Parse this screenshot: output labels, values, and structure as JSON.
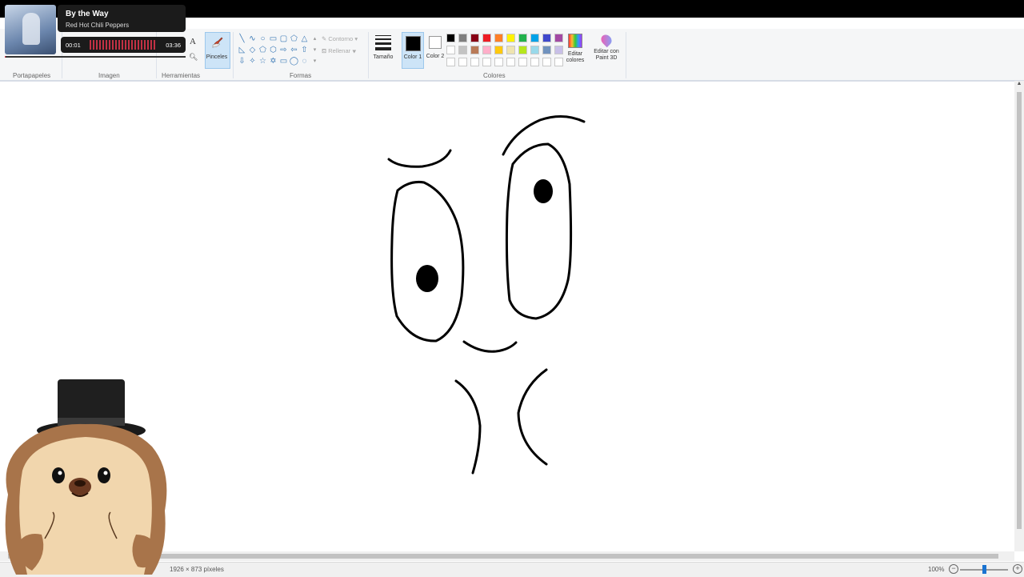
{
  "ribbon": {
    "groups": {
      "clipboard": "Portapapeles",
      "image": "Imagen",
      "tools": "Herramientas",
      "shapes": "Formas",
      "colors": "Colores"
    },
    "brushes_label": "Pinceles",
    "outline_label": "Contorno",
    "fill_label": "Rellenar",
    "size_label": "Tamaño",
    "color1_label": "Color 1",
    "color2_label": "Color 2",
    "edit_colors_label": "Editar colores",
    "paint3d_label": "Editar con Paint 3D",
    "color1_value": "#000000",
    "color2_value": "#ffffff",
    "palette": [
      "#000000",
      "#7f7f7f",
      "#880015",
      "#ed1c24",
      "#ff7f27",
      "#fff200",
      "#22b14c",
      "#00a2e8",
      "#3f48cc",
      "#a349a4",
      "#ffffff",
      "#c3c3c3",
      "#b97a57",
      "#ffaec9",
      "#ffc90e",
      "#efe4b0",
      "#b5e61d",
      "#99d9ea",
      "#7092be",
      "#c8bfe7",
      "#ffffff",
      "#ffffff",
      "#ffffff",
      "#ffffff",
      "#ffffff",
      "#ffffff",
      "#ffffff",
      "#ffffff",
      "#ffffff",
      "#ffffff"
    ]
  },
  "music_widget": {
    "title": "By the Way",
    "artist": "Red Hot Chili Peppers",
    "elapsed": "00:01",
    "duration": "03:36",
    "progress": 0.005
  },
  "status": {
    "dimensions": "1926 × 873 píxeles",
    "zoom": "100%"
  }
}
